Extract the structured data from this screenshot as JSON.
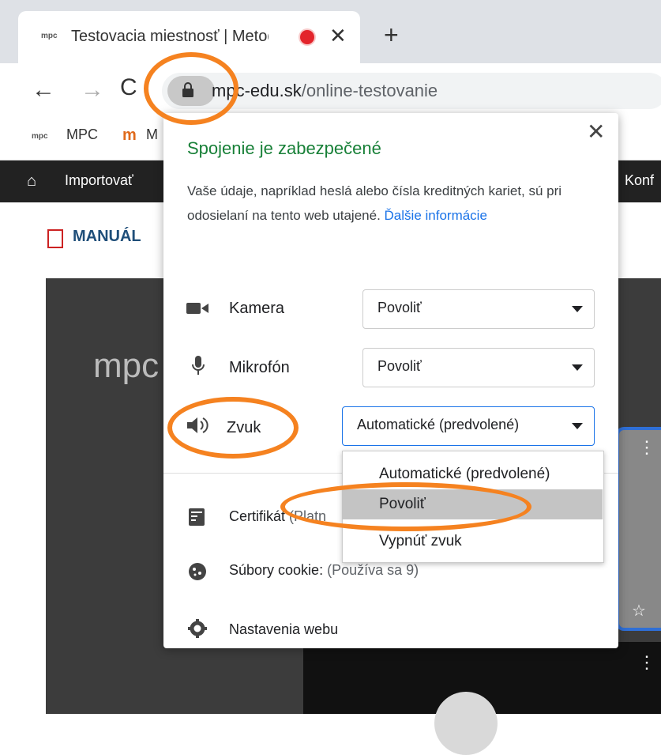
{
  "browser": {
    "tab_favicon": "mpc",
    "tab_title": "Testovacia miestnosť | Metod",
    "tab_close": "✕",
    "new_tab": "+",
    "url_host_prefix": "m",
    "url_host": "pc-edu.sk",
    "url_path": "/online-testovanie"
  },
  "bookmarks": [
    {
      "icon": "mpc",
      "label": "MPC"
    },
    {
      "icon": "m",
      "label": "M"
    }
  ],
  "site_nav": {
    "home_icon": "home-icon",
    "import_label": "Importovať",
    "right_label": "Konf"
  },
  "page": {
    "manual_label": "MANUÁL",
    "watermark": "mpc",
    "tile_menu": "⋮",
    "tile_star": "☆"
  },
  "popup": {
    "title": "Spojenie je zabezpečené",
    "desc": "Vaše údaje, napríklad heslá alebo čísla kreditných karieť, sú pri odosielaní na tento web utajené.",
    "desc_text": "Vaše údaje, napríklad heslá alebo čísla kreditných kariet, sú pri odosielaní na tento web utajené. ",
    "more_link": "Ďalšie informácie",
    "close": "✕",
    "permissions": [
      {
        "icon": "camera-icon",
        "label": "Kamera",
        "value": "Povoliť"
      },
      {
        "icon": "microphone-icon",
        "label": "Mikrofón",
        "value": "Povoliť"
      },
      {
        "icon": "speaker-icon",
        "label": "Zvuk",
        "value": "Automatické (predvolené)"
      }
    ],
    "rows": [
      {
        "icon": "certificate-icon",
        "label": "Certifikát",
        "detail": "(Platn"
      },
      {
        "icon": "cookie-icon",
        "label": "Súbory cookie:",
        "detail": "(Používa sa 9)"
      },
      {
        "icon": "gear-icon",
        "label": "Nastavenia webu",
        "detail": ""
      }
    ]
  },
  "dropdown": {
    "options": [
      "Automatické (predvolené)",
      "Povoliť",
      "Vypnúť zvuk"
    ],
    "highlighted_index": 1
  },
  "annotation_color": "#f58220"
}
